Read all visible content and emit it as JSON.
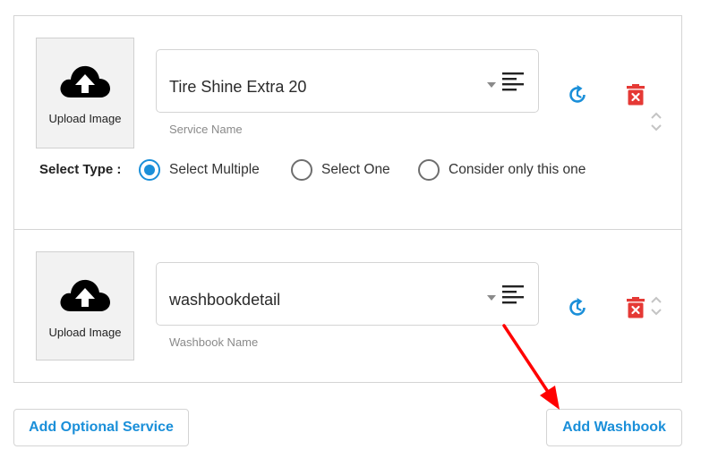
{
  "services": [
    {
      "upload_label": "Upload Image",
      "name_value": "Tire Shine Extra 20",
      "name_helper": "Service Name"
    },
    {
      "upload_label": "Upload Image",
      "name_value": "washbookdetail",
      "name_helper": "Washbook Name"
    }
  ],
  "select_type": {
    "label": "Select Type :",
    "options": [
      {
        "label": "Select Multiple",
        "selected": true
      },
      {
        "label": "Select One",
        "selected": false
      },
      {
        "label": "Consider only this one",
        "selected": false
      }
    ]
  },
  "buttons": {
    "add_optional_service": "Add Optional Service",
    "add_washbook": "Add Washbook"
  },
  "colors": {
    "accent_blue": "#1a8fd9",
    "delete_red": "#e53935",
    "annotation_red": "#ff0000"
  },
  "icons": {
    "upload": "cloud-upload-icon",
    "list": "list-icon",
    "reset": "refresh-icon",
    "delete": "trash-icon",
    "reorder": "chevron-up-down-icon"
  }
}
